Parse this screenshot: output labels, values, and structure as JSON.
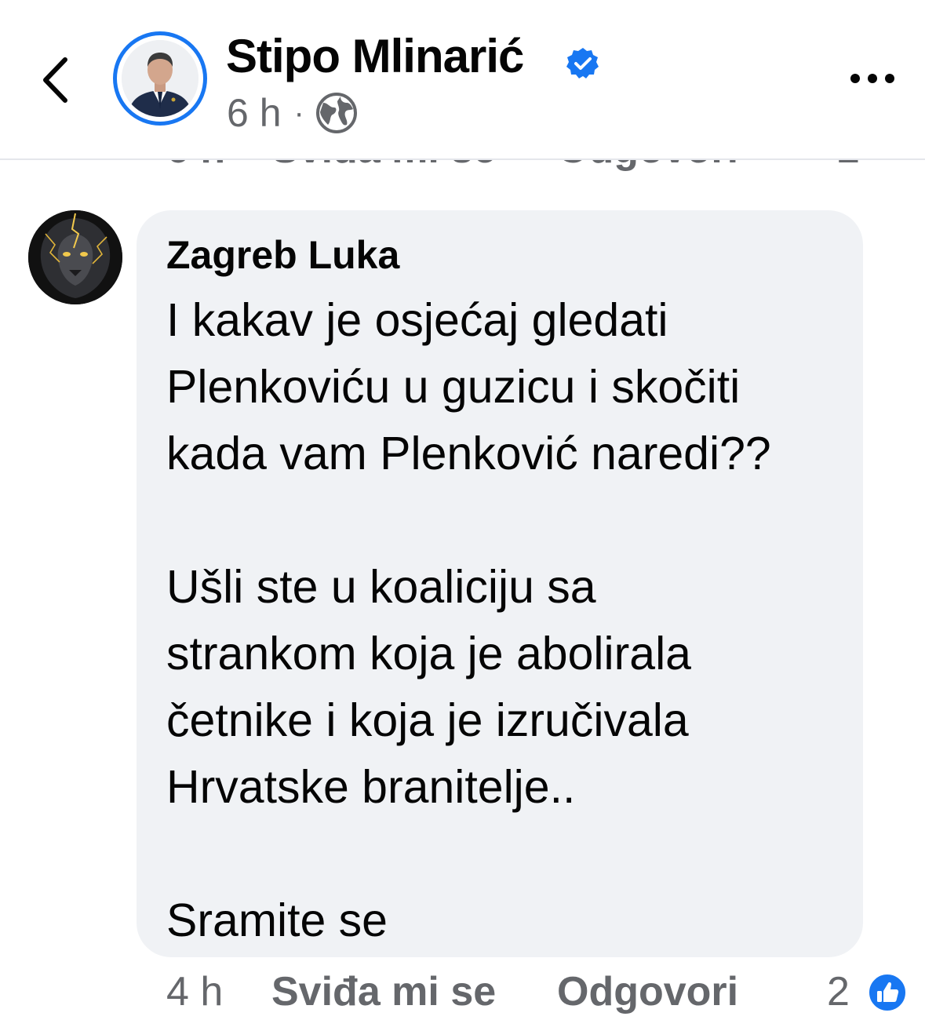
{
  "header": {
    "page_name": "Stipo Mlinarić",
    "verified": true,
    "post_time": "6 h",
    "separator": "·",
    "privacy_icon": "globe-icon",
    "back_icon": "chevron-left-icon",
    "more_icon": "more-horizontal-icon"
  },
  "comment": {
    "author": "Zagreb Luka",
    "lines": [
      "I kakav je osjećaj gledati",
      "Plenkoviću u guzicu i skočiti",
      "kada vam Plenković naredi??",
      "",
      "Ušli ste u koaliciju sa",
      "strankom koja je abolirala",
      "četnike i koja je izručivala",
      "Hrvatske branitelje..",
      "",
      "Sramite se"
    ],
    "time": "4 h",
    "like_label": "Sviđa mi se",
    "reply_label": "Odgovori",
    "reaction_count": "2",
    "reaction_icon": "like-reaction-icon"
  },
  "colors": {
    "accent": "#1877f2",
    "bubble": "#f0f2f5",
    "secondary_text": "#65676b",
    "primary_text": "#050505"
  }
}
